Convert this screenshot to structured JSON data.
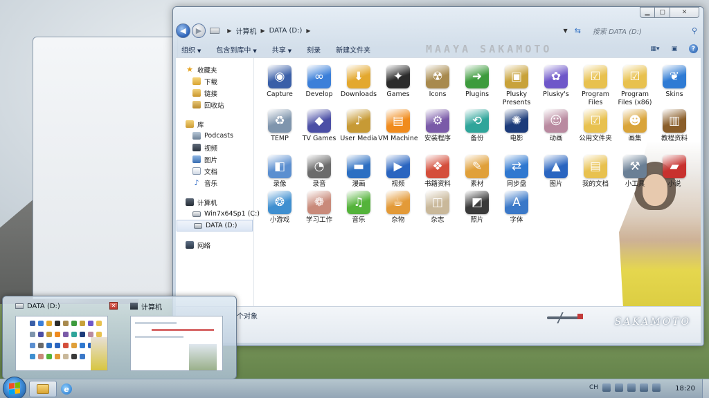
{
  "window": {
    "caption_min": "▁",
    "caption_max": "▢",
    "caption_close": "✕"
  },
  "address": {
    "crumbs": [
      "计算机",
      "DATA (D:)"
    ],
    "search_placeholder": "搜索 DATA (D:)"
  },
  "toolbar": {
    "organize": "组织",
    "include_in_library": "包含到库中",
    "share": "共享",
    "burn": "刻录",
    "new_folder": "新建文件夹",
    "brand": "MAAYA SAKAMOTO",
    "help": "?"
  },
  "nav": {
    "favorites": "收藏夹",
    "downloads": "下载",
    "links": "链接",
    "recent": "回收站",
    "libraries": "库",
    "podcasts": "Podcasts",
    "videos": "视频",
    "pictures": "图片",
    "documents": "文档",
    "music": "音乐",
    "computer": "计算机",
    "drive_c": "Win7x64Sp1 (C:)",
    "drive_d": "DATA (D:)",
    "network": "网络"
  },
  "files": [
    {
      "label": "Capture",
      "icon": "eye-icon",
      "color": "#3a5fa8",
      "glyph": "◉"
    },
    {
      "label": "Develop",
      "icon": "infinity-icon",
      "color": "#3b7fd9",
      "glyph": "∞"
    },
    {
      "label": "Downloads",
      "icon": "folder-download-icon",
      "color": "#e3a82e",
      "glyph": "⬇"
    },
    {
      "label": "Games",
      "icon": "creature-icon",
      "color": "#2b2b2b",
      "glyph": "✦"
    },
    {
      "label": "Icons",
      "icon": "box-icon",
      "color": "#a88a4e",
      "glyph": "☢"
    },
    {
      "label": "Plugins",
      "icon": "arrow-icon",
      "color": "#3d9b3d",
      "glyph": "➜"
    },
    {
      "label": "Plusky Presents",
      "icon": "treasure-box-icon",
      "color": "#c8a23a",
      "glyph": "▣"
    },
    {
      "label": "Plusky's",
      "icon": "anime-icon",
      "color": "#6e57c9",
      "glyph": "✿"
    },
    {
      "label": "Program Files",
      "icon": "folder-list-icon",
      "color": "#e8c14f",
      "glyph": "☑"
    },
    {
      "label": "Program Files (x86)",
      "icon": "folder-list-icon",
      "color": "#e8c14f",
      "glyph": "☑"
    },
    {
      "label": "Skins",
      "icon": "feather-icon",
      "color": "#2f7bd4",
      "glyph": "❦"
    },
    {
      "label": "TEMP",
      "icon": "recycle-bin-icon",
      "color": "#7f95ad",
      "glyph": "♻"
    },
    {
      "label": "TV Games",
      "icon": "gamecube-icon",
      "color": "#4b4fa6",
      "glyph": "◆"
    },
    {
      "label": "User Media",
      "icon": "media-folder-icon",
      "color": "#c79a35",
      "glyph": "♪"
    },
    {
      "label": "VM Machine",
      "icon": "vm-icon",
      "color": "#f08b1d",
      "glyph": "▤"
    },
    {
      "label": "安装程序",
      "icon": "installer-icon",
      "color": "#7a5aa8",
      "glyph": "⚙"
    },
    {
      "label": "备份",
      "icon": "backup-icon",
      "color": "#2fa59a",
      "glyph": "⟲"
    },
    {
      "label": "电影",
      "icon": "film-reel-icon",
      "color": "#1c3b7a",
      "glyph": "✺"
    },
    {
      "label": "动画",
      "icon": "anime-girl-icon",
      "color": "#b98aa0",
      "glyph": "☺"
    },
    {
      "label": "公用文件夹",
      "icon": "folder-list-icon",
      "color": "#e8c14f",
      "glyph": "☑"
    },
    {
      "label": "画集",
      "icon": "popeye-icon",
      "color": "#d9a43a",
      "glyph": "☻"
    },
    {
      "label": "教程资料",
      "icon": "briefcase-icon",
      "color": "#8a5e2a",
      "glyph": "▥"
    },
    {
      "label": "录像",
      "icon": "camera-folder-icon",
      "color": "#5b8fd0",
      "glyph": "◧"
    },
    {
      "label": "录音",
      "icon": "speaker-icon",
      "color": "#6b6b6b",
      "glyph": "◔"
    },
    {
      "label": "漫画",
      "icon": "book-icon",
      "color": "#2c6fc2",
      "glyph": "▬"
    },
    {
      "label": "视频",
      "icon": "video-folder-icon",
      "color": "#2a65c0",
      "glyph": "▶"
    },
    {
      "label": "书籍资料",
      "icon": "books-icon",
      "color": "#d44e3b",
      "glyph": "❖"
    },
    {
      "label": "素材",
      "icon": "palette-icon",
      "color": "#e0a03a",
      "glyph": "✎"
    },
    {
      "label": "同步盘",
      "icon": "sync-icon",
      "color": "#2f78d0",
      "glyph": "⇄"
    },
    {
      "label": "图片",
      "icon": "picture-folder-icon",
      "color": "#2a65c0",
      "glyph": "▲"
    },
    {
      "label": "我的文档",
      "icon": "documents-folder-icon",
      "color": "#e8c14f",
      "glyph": "▤"
    },
    {
      "label": "小工具",
      "icon": "robot-icon",
      "color": "#6a7f95",
      "glyph": "⚒"
    },
    {
      "label": "小说",
      "icon": "red-book-icon",
      "color": "#c8312e",
      "glyph": "▰"
    },
    {
      "label": "小游戏",
      "icon": "hamster-icon",
      "color": "#3f8fd0",
      "glyph": "❂"
    },
    {
      "label": "学习工作",
      "icon": "brain-icon",
      "color": "#c98a7a",
      "glyph": "❁"
    },
    {
      "label": "音乐",
      "icon": "music-note-icon",
      "color": "#54b33a",
      "glyph": "♫"
    },
    {
      "label": "杂物",
      "icon": "cup-icon",
      "color": "#e39a38",
      "glyph": "☕"
    },
    {
      "label": "杂志",
      "icon": "magazine-icon",
      "color": "#c9b89a",
      "glyph": "◫"
    },
    {
      "label": "照片",
      "icon": "photo-icon",
      "color": "#3a3a3a",
      "glyph": "◩"
    },
    {
      "label": "字体",
      "icon": "font-icon",
      "color": "#3a78c8",
      "glyph": "A"
    }
  ],
  "status": {
    "text": "个对象",
    "signature": "SAKAMOTO"
  },
  "thumbnails": [
    {
      "title": "DATA (D:)",
      "close": "✕"
    },
    {
      "title": "计算机"
    }
  ],
  "taskbar": {
    "tray_text": "CH",
    "clock": "18:20"
  }
}
